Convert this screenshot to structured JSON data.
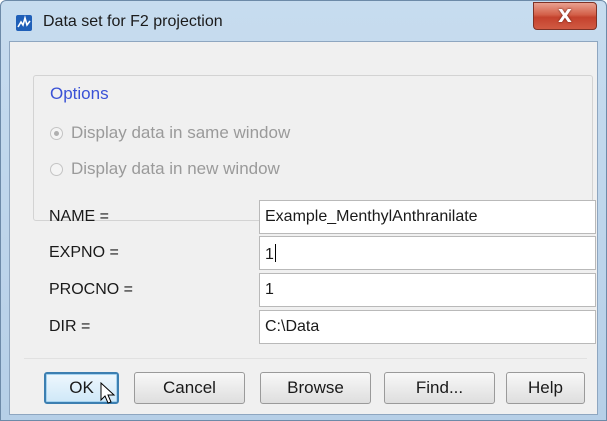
{
  "window": {
    "title": "Data set for F2 projection",
    "close_glyph": "X",
    "accent": "#3c7fb1"
  },
  "options": {
    "legend": "Options",
    "same_window_label": "Display data in same window",
    "new_window_label": "Display data in new window",
    "selected": "same_window"
  },
  "fields": {
    "name": {
      "label": "NAME =",
      "value": "Example_MenthylAnthranilate"
    },
    "expno": {
      "label": "EXPNO =",
      "value": "1"
    },
    "procno": {
      "label": "PROCNO =",
      "value": "1"
    },
    "dir": {
      "label": "DIR =",
      "value": "C:\\Data"
    }
  },
  "buttons": {
    "ok": "OK",
    "cancel": "Cancel",
    "browse": "Browse",
    "find": "Find...",
    "help": "Help"
  },
  "icons": {
    "app": "topspin-app-icon",
    "close": "close-icon",
    "cursor": "mouse-pointer-icon"
  }
}
